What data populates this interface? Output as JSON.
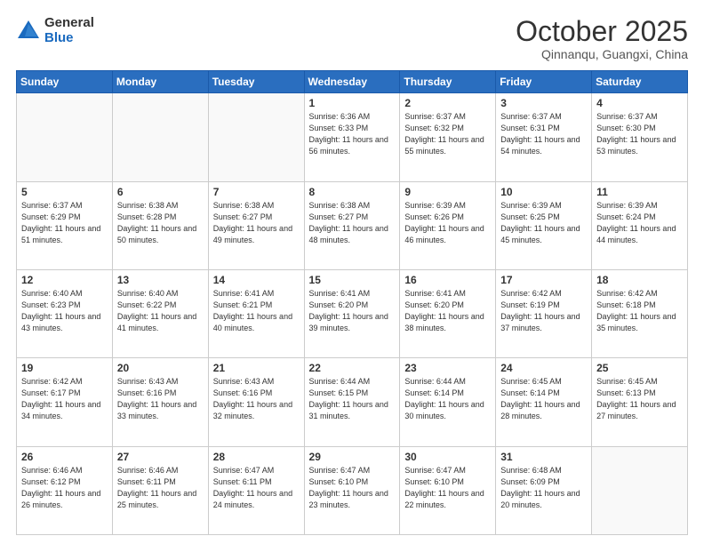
{
  "header": {
    "logo_general": "General",
    "logo_blue": "Blue",
    "month_title": "October 2025",
    "subtitle": "Qinnanqu, Guangxi, China"
  },
  "weekdays": [
    "Sunday",
    "Monday",
    "Tuesday",
    "Wednesday",
    "Thursday",
    "Friday",
    "Saturday"
  ],
  "weeks": [
    [
      {
        "day": "",
        "sunrise": "",
        "sunset": "",
        "daylight": ""
      },
      {
        "day": "",
        "sunrise": "",
        "sunset": "",
        "daylight": ""
      },
      {
        "day": "",
        "sunrise": "",
        "sunset": "",
        "daylight": ""
      },
      {
        "day": "1",
        "sunrise": "Sunrise: 6:36 AM",
        "sunset": "Sunset: 6:33 PM",
        "daylight": "Daylight: 11 hours and 56 minutes."
      },
      {
        "day": "2",
        "sunrise": "Sunrise: 6:37 AM",
        "sunset": "Sunset: 6:32 PM",
        "daylight": "Daylight: 11 hours and 55 minutes."
      },
      {
        "day": "3",
        "sunrise": "Sunrise: 6:37 AM",
        "sunset": "Sunset: 6:31 PM",
        "daylight": "Daylight: 11 hours and 54 minutes."
      },
      {
        "day": "4",
        "sunrise": "Sunrise: 6:37 AM",
        "sunset": "Sunset: 6:30 PM",
        "daylight": "Daylight: 11 hours and 53 minutes."
      }
    ],
    [
      {
        "day": "5",
        "sunrise": "Sunrise: 6:37 AM",
        "sunset": "Sunset: 6:29 PM",
        "daylight": "Daylight: 11 hours and 51 minutes."
      },
      {
        "day": "6",
        "sunrise": "Sunrise: 6:38 AM",
        "sunset": "Sunset: 6:28 PM",
        "daylight": "Daylight: 11 hours and 50 minutes."
      },
      {
        "day": "7",
        "sunrise": "Sunrise: 6:38 AM",
        "sunset": "Sunset: 6:27 PM",
        "daylight": "Daylight: 11 hours and 49 minutes."
      },
      {
        "day": "8",
        "sunrise": "Sunrise: 6:38 AM",
        "sunset": "Sunset: 6:27 PM",
        "daylight": "Daylight: 11 hours and 48 minutes."
      },
      {
        "day": "9",
        "sunrise": "Sunrise: 6:39 AM",
        "sunset": "Sunset: 6:26 PM",
        "daylight": "Daylight: 11 hours and 46 minutes."
      },
      {
        "day": "10",
        "sunrise": "Sunrise: 6:39 AM",
        "sunset": "Sunset: 6:25 PM",
        "daylight": "Daylight: 11 hours and 45 minutes."
      },
      {
        "day": "11",
        "sunrise": "Sunrise: 6:39 AM",
        "sunset": "Sunset: 6:24 PM",
        "daylight": "Daylight: 11 hours and 44 minutes."
      }
    ],
    [
      {
        "day": "12",
        "sunrise": "Sunrise: 6:40 AM",
        "sunset": "Sunset: 6:23 PM",
        "daylight": "Daylight: 11 hours and 43 minutes."
      },
      {
        "day": "13",
        "sunrise": "Sunrise: 6:40 AM",
        "sunset": "Sunset: 6:22 PM",
        "daylight": "Daylight: 11 hours and 41 minutes."
      },
      {
        "day": "14",
        "sunrise": "Sunrise: 6:41 AM",
        "sunset": "Sunset: 6:21 PM",
        "daylight": "Daylight: 11 hours and 40 minutes."
      },
      {
        "day": "15",
        "sunrise": "Sunrise: 6:41 AM",
        "sunset": "Sunset: 6:20 PM",
        "daylight": "Daylight: 11 hours and 39 minutes."
      },
      {
        "day": "16",
        "sunrise": "Sunrise: 6:41 AM",
        "sunset": "Sunset: 6:20 PM",
        "daylight": "Daylight: 11 hours and 38 minutes."
      },
      {
        "day": "17",
        "sunrise": "Sunrise: 6:42 AM",
        "sunset": "Sunset: 6:19 PM",
        "daylight": "Daylight: 11 hours and 37 minutes."
      },
      {
        "day": "18",
        "sunrise": "Sunrise: 6:42 AM",
        "sunset": "Sunset: 6:18 PM",
        "daylight": "Daylight: 11 hours and 35 minutes."
      }
    ],
    [
      {
        "day": "19",
        "sunrise": "Sunrise: 6:42 AM",
        "sunset": "Sunset: 6:17 PM",
        "daylight": "Daylight: 11 hours and 34 minutes."
      },
      {
        "day": "20",
        "sunrise": "Sunrise: 6:43 AM",
        "sunset": "Sunset: 6:16 PM",
        "daylight": "Daylight: 11 hours and 33 minutes."
      },
      {
        "day": "21",
        "sunrise": "Sunrise: 6:43 AM",
        "sunset": "Sunset: 6:16 PM",
        "daylight": "Daylight: 11 hours and 32 minutes."
      },
      {
        "day": "22",
        "sunrise": "Sunrise: 6:44 AM",
        "sunset": "Sunset: 6:15 PM",
        "daylight": "Daylight: 11 hours and 31 minutes."
      },
      {
        "day": "23",
        "sunrise": "Sunrise: 6:44 AM",
        "sunset": "Sunset: 6:14 PM",
        "daylight": "Daylight: 11 hours and 30 minutes."
      },
      {
        "day": "24",
        "sunrise": "Sunrise: 6:45 AM",
        "sunset": "Sunset: 6:14 PM",
        "daylight": "Daylight: 11 hours and 28 minutes."
      },
      {
        "day": "25",
        "sunrise": "Sunrise: 6:45 AM",
        "sunset": "Sunset: 6:13 PM",
        "daylight": "Daylight: 11 hours and 27 minutes."
      }
    ],
    [
      {
        "day": "26",
        "sunrise": "Sunrise: 6:46 AM",
        "sunset": "Sunset: 6:12 PM",
        "daylight": "Daylight: 11 hours and 26 minutes."
      },
      {
        "day": "27",
        "sunrise": "Sunrise: 6:46 AM",
        "sunset": "Sunset: 6:11 PM",
        "daylight": "Daylight: 11 hours and 25 minutes."
      },
      {
        "day": "28",
        "sunrise": "Sunrise: 6:47 AM",
        "sunset": "Sunset: 6:11 PM",
        "daylight": "Daylight: 11 hours and 24 minutes."
      },
      {
        "day": "29",
        "sunrise": "Sunrise: 6:47 AM",
        "sunset": "Sunset: 6:10 PM",
        "daylight": "Daylight: 11 hours and 23 minutes."
      },
      {
        "day": "30",
        "sunrise": "Sunrise: 6:47 AM",
        "sunset": "Sunset: 6:10 PM",
        "daylight": "Daylight: 11 hours and 22 minutes."
      },
      {
        "day": "31",
        "sunrise": "Sunrise: 6:48 AM",
        "sunset": "Sunset: 6:09 PM",
        "daylight": "Daylight: 11 hours and 20 minutes."
      },
      {
        "day": "",
        "sunrise": "",
        "sunset": "",
        "daylight": ""
      }
    ]
  ]
}
